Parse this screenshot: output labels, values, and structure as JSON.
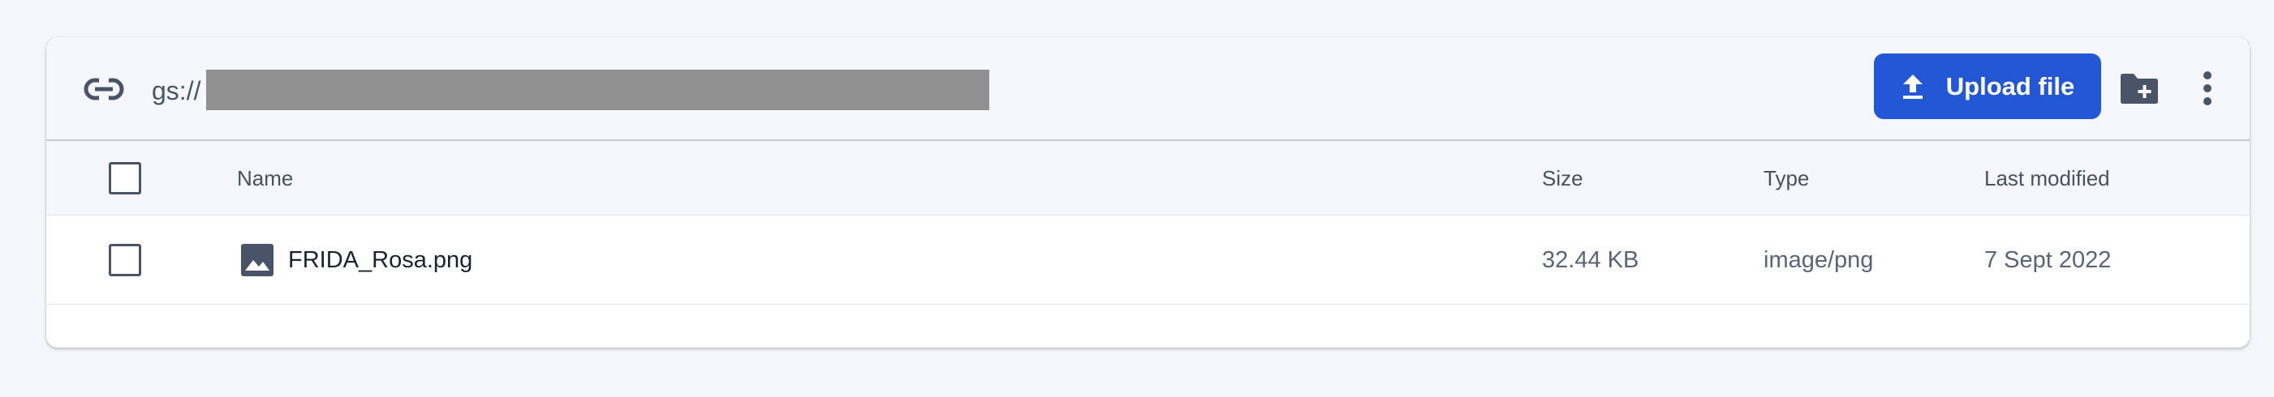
{
  "toolbar": {
    "path_prefix": "gs://",
    "upload_label": "Upload file"
  },
  "table": {
    "columns": [
      "Name",
      "Size",
      "Type",
      "Last modified"
    ],
    "rows": [
      {
        "name": "FRIDA_Rosa.png",
        "size": "32.44 KB",
        "type": "image/png",
        "modified": "7 Sept 2022"
      }
    ]
  },
  "colors": {
    "accent": "#2457d6",
    "icon": "#4a5468"
  },
  "icons": {
    "link": "link-icon",
    "upload": "upload-icon",
    "new_folder": "new-folder-icon",
    "more": "more-vert-icon",
    "file": "image-file-icon"
  }
}
